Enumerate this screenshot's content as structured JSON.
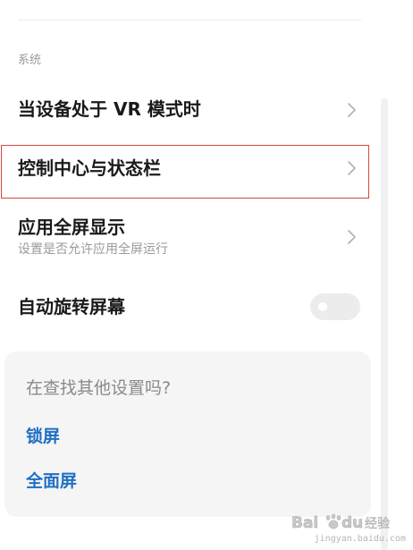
{
  "section": {
    "header": "系统"
  },
  "rows": [
    {
      "title": "当设备处于 VR 模式时"
    },
    {
      "title": "控制中心与状态栏"
    },
    {
      "title": "应用全屏显示",
      "subtitle": "设置是否允许应用全屏运行"
    },
    {
      "title": "自动旋转屏幕",
      "toggle_on": false
    }
  ],
  "suggestions": {
    "title": "在查找其他设置吗?",
    "links": [
      "锁屏",
      "全面屏"
    ]
  },
  "watermark": {
    "text": "Bai du 经验",
    "sub": "jingyan.baidu.com"
  },
  "colors": {
    "highlight": "#d9463e",
    "link": "#1f6fc5",
    "card_bg": "#f5f5f5",
    "toggle_off": "#ececec"
  },
  "icons": {
    "row_arrow": "chevron-right-icon",
    "watermark_logo": "baidu-paw-logo"
  }
}
